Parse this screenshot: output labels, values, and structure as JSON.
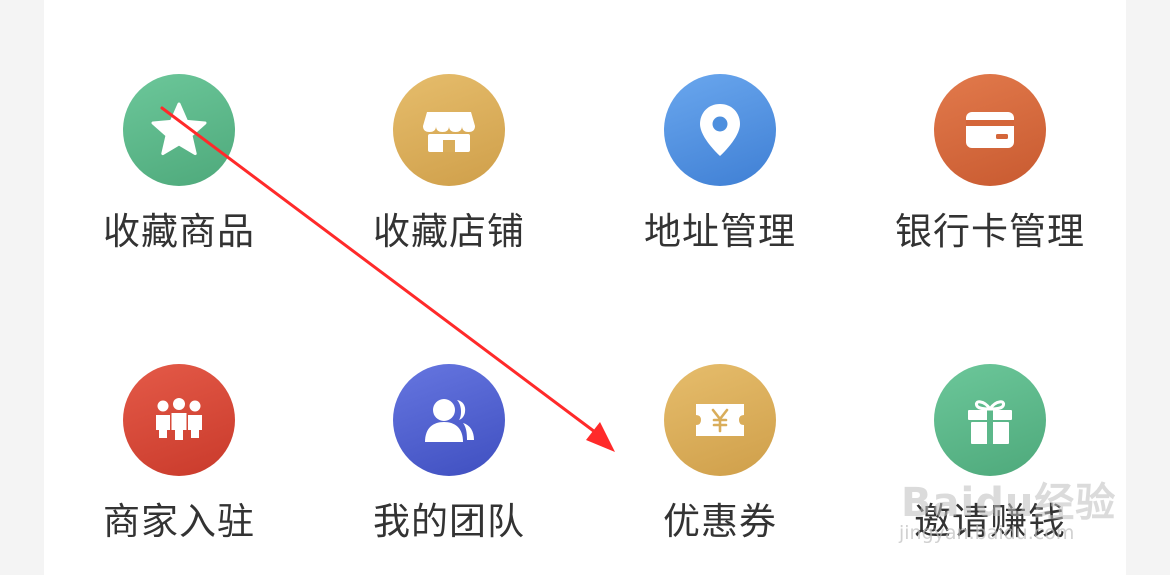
{
  "menu": {
    "items": [
      {
        "label": "收藏商品",
        "icon": "star-icon",
        "color": "#5cb88a"
      },
      {
        "label": "收藏店铺",
        "icon": "store-icon",
        "color": "#d9ad5a"
      },
      {
        "label": "地址管理",
        "icon": "location-pin-icon",
        "color": "#4d8fde"
      },
      {
        "label": "银行卡管理",
        "icon": "bank-card-icon",
        "color": "#d4663a"
      },
      {
        "label": "商家入驻",
        "icon": "people-group-icon",
        "color": "#d94a3a"
      },
      {
        "label": "我的团队",
        "icon": "team-icon",
        "color": "#5062d0"
      },
      {
        "label": "优惠券",
        "icon": "coupon-icon",
        "color": "#d9ad5a"
      },
      {
        "label": "邀请赚钱",
        "icon": "gift-icon",
        "color": "#5cb88a"
      }
    ]
  },
  "watermark": {
    "main": "Baidu经验",
    "sub": "jingyan.baidu.com"
  },
  "annotation": {
    "color": "#ff2a2a"
  }
}
